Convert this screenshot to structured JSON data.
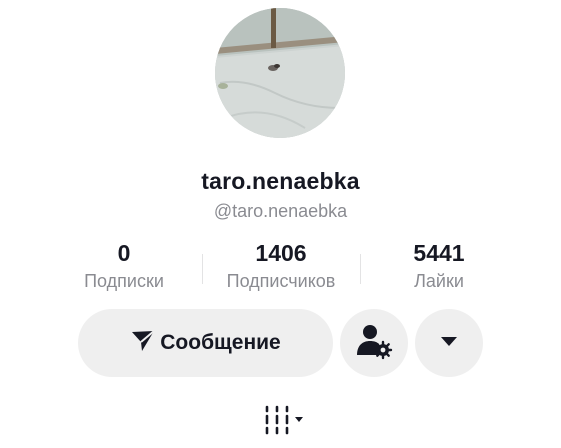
{
  "profile": {
    "display_name": "taro.nenaebka",
    "handle": "@taro.nenaebka",
    "avatar_description": "avatar-photo"
  },
  "stats": {
    "following": {
      "value": "0",
      "label": "Подписки"
    },
    "followers": {
      "value": "1406",
      "label": "Подписчиков"
    },
    "likes": {
      "value": "5441",
      "label": "Лайки"
    }
  },
  "actions": {
    "message_label": "Сообщение",
    "message_icon": "send-icon",
    "add_friend_icon": "user-settings-icon",
    "more_icon": "caret-down-icon"
  },
  "tabs": {
    "active_icon": "grid-columns-icon"
  },
  "colors": {
    "text_primary": "#161823",
    "text_secondary": "#8a8b91",
    "button_bg": "#efefef"
  }
}
